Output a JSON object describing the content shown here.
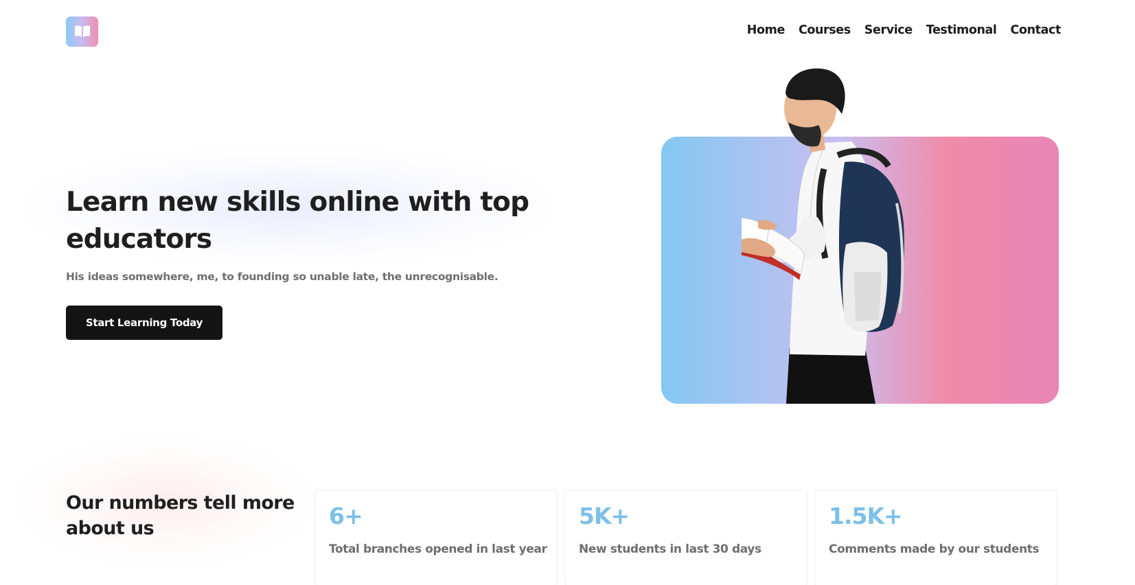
{
  "header": {
    "logo_icon": "open-book-icon",
    "nav": [
      "Home",
      "Courses",
      "Service",
      "Testimonal",
      "Contact"
    ]
  },
  "hero": {
    "title": "Learn new skills online with top educators",
    "subtitle": "His ideas somewhere, me, to founding so unable late, the unrecognisable.",
    "cta_label": "Start Learning Today",
    "image": "student-reading-book-with-backpack",
    "gradient_colors": [
      "#84c8f3",
      "#c9bff0",
      "#f08aa8",
      "#e886b6"
    ]
  },
  "stats": {
    "title": "Our numbers tell more about us",
    "accent_color": "#7cc0ea",
    "items": [
      {
        "value": "6+",
        "label": "Total branches opened in last year"
      },
      {
        "value": "5K+",
        "label": "New students in last 30 days"
      },
      {
        "value": "1.5K+",
        "label": "Comments made by our students"
      }
    ]
  }
}
